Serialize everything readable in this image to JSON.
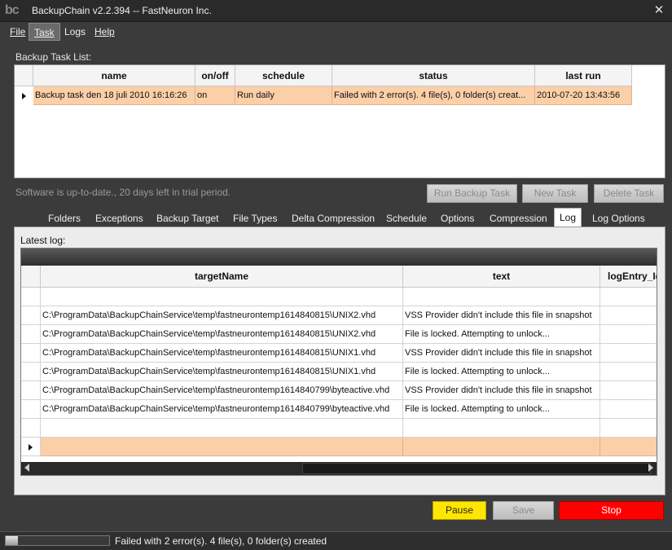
{
  "window": {
    "icon_text": "bc",
    "title": "BackupChain v2.2.394 -- FastNeuron Inc.",
    "close_glyph": "✕"
  },
  "menu": [
    "File",
    "Task",
    "Logs",
    "Help"
  ],
  "task_list": {
    "label": "Backup Task List:",
    "columns": [
      "name",
      "on/off",
      "schedule",
      "status",
      "last run"
    ],
    "rows": [
      {
        "name": "Backup task den 18 juli 2010 16:16:26",
        "onoff": "on",
        "schedule": "Run daily",
        "status": "Failed with 2 error(s). 4 file(s), 0 folder(s) creat...",
        "last_run": "2010-07-20 13:43:56"
      }
    ]
  },
  "trial_status": "Software is up-to-date., 20 days left in trial period.",
  "task_buttons": {
    "run": "Run Backup Task",
    "new": "New Task",
    "delete": "Delete Task"
  },
  "tabs": [
    "Folders",
    "Exceptions",
    "Backup Target",
    "File Types",
    "Delta Compression",
    "Schedule",
    "Options",
    "Compression",
    "Log",
    "Log Options"
  ],
  "active_tab": "Log",
  "log": {
    "label": "Latest log:",
    "columns": [
      "targetName",
      "text",
      "logEntry_Id"
    ],
    "rows": [
      {
        "target": "",
        "text": ""
      },
      {
        "target": "C:\\ProgramData\\BackupChainService\\temp\\fastneurontemp1614840815\\UNIX2.vhd",
        "text": "VSS Provider didn't include this file in snapshot"
      },
      {
        "target": "C:\\ProgramData\\BackupChainService\\temp\\fastneurontemp1614840815\\UNIX2.vhd",
        "text": "File is locked. Attempting to unlock..."
      },
      {
        "target": "C:\\ProgramData\\BackupChainService\\temp\\fastneurontemp1614840815\\UNIX1.vhd",
        "text": "VSS Provider didn't include this file in snapshot"
      },
      {
        "target": "C:\\ProgramData\\BackupChainService\\temp\\fastneurontemp1614840815\\UNIX1.vhd",
        "text": "File is locked. Attempting to unlock..."
      },
      {
        "target": "C:\\ProgramData\\BackupChainService\\temp\\fastneurontemp1614840799\\byteactive.vhd",
        "text": "VSS Provider didn't include this file in snapshot"
      },
      {
        "target": "C:\\ProgramData\\BackupChainService\\temp\\fastneurontemp1614840799\\byteactive.vhd",
        "text": "File is locked. Attempting to unlock..."
      },
      {
        "target": "",
        "text": ""
      }
    ]
  },
  "action_buttons": {
    "pause": "Pause",
    "save": "Save",
    "stop": "Stop"
  },
  "colors": {
    "pause": "#ffe600",
    "stop": "#ff0000",
    "row_highlight": "#fbcfa8"
  },
  "statusbar": {
    "progress": 0.12,
    "text": "Failed with 2 error(s). 4 file(s), 0 folder(s) created"
  }
}
